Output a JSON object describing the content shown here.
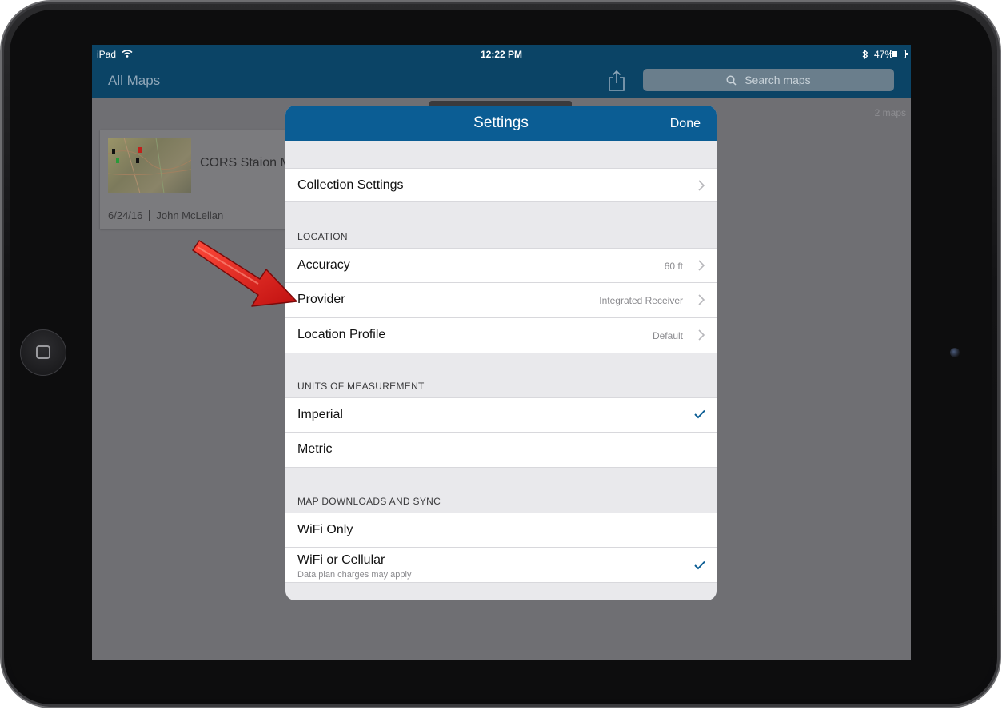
{
  "status_bar": {
    "device": "iPad",
    "time": "12:22 PM",
    "battery": "47%"
  },
  "nav": {
    "title": "All Maps",
    "search_placeholder": "Search maps"
  },
  "content": {
    "map_count": "2 maps",
    "map_card": {
      "name": "CORS Staion M",
      "date": "6/24/16",
      "author": "John McLellan"
    }
  },
  "modal": {
    "title": "Settings",
    "done": "Done",
    "collection_settings": "Collection Settings",
    "location_header": "LOCATION",
    "location_rows": [
      {
        "label": "Accuracy",
        "value": "60 ft"
      },
      {
        "label": "Provider",
        "value": "Integrated Receiver"
      },
      {
        "label": "Location Profile",
        "value": "Default"
      }
    ],
    "units_header": "UNITS OF MEASUREMENT",
    "units_rows": [
      {
        "label": "Imperial",
        "checked": true
      },
      {
        "label": "Metric",
        "checked": false
      }
    ],
    "downloads_header": "MAP DOWNLOADS AND SYNC",
    "downloads_rows": [
      {
        "label": "WiFi Only",
        "checked": false
      },
      {
        "label": "WiFi or Cellular",
        "subtitle": "Data plan charges may apply",
        "checked": true
      }
    ]
  },
  "colors": {
    "accent": "#0b5d94",
    "navbar": "#0b4466",
    "arrow": "#e0201e"
  }
}
